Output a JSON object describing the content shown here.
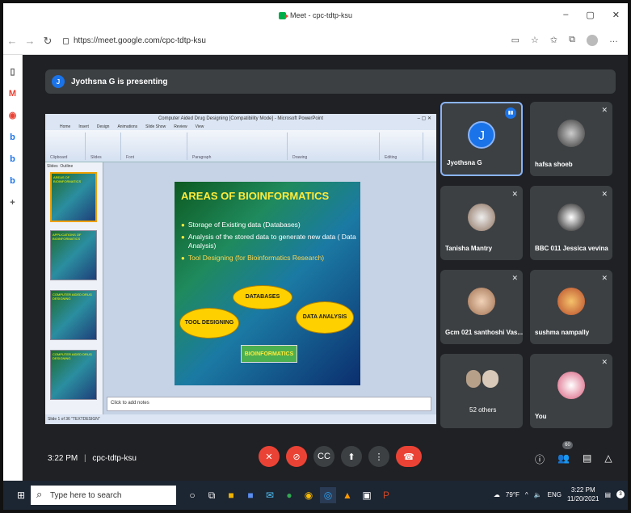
{
  "browser": {
    "tab_title": "Meet - cpc-tdtp-ksu",
    "url": "https://meet.google.com/cpc-tdtp-ksu",
    "window_controls": {
      "minimize": "–",
      "maximize": "▢",
      "close": "✕"
    }
  },
  "meet": {
    "banner_text": "Jyothsna G is presenting",
    "time": "3:22 PM",
    "separator": "|",
    "meeting_code": "cpc-tdtp-ksu",
    "people_count": "60"
  },
  "presentation": {
    "window_title": "Computer Aided Drug Designing [Compatibility Mode] - Microsoft PowerPoint",
    "ribbon_tabs": [
      "Home",
      "Insert",
      "Design",
      "Animations",
      "Slide Show",
      "Review",
      "View"
    ],
    "ribbon_groups": [
      "Clipboard",
      "Slides",
      "Font",
      "Paragraph",
      "Drawing",
      "Editing"
    ],
    "panel_tabs": [
      "Slides",
      "Outline"
    ],
    "thumbnails": [
      {
        "num": "",
        "title": "AREAS OF BIOINFORMATICS"
      },
      {
        "num": "",
        "title": "APPLICATIONS OF BIOINFORMATICS"
      },
      {
        "num": "",
        "title": "COMPUTER AIDED DRUG DESIGNING"
      },
      {
        "num": "",
        "title": "COMPUTER AIDED DRUG DESIGNING"
      }
    ],
    "slide": {
      "title": "AREAS OF BIOINFORMATICS",
      "bullets": [
        "Storage of Existing data (Databases)",
        "Analysis of the stored data to generate new data ( Data Analysis)",
        "Tool Designing (for Bioinformatics Research)"
      ],
      "ellipse_databases": "DATABASES",
      "ellipse_tool": "TOOL DESIGNING",
      "ellipse_data": "DATA ANALYSIS",
      "center_box": "BIOINFORMATICS"
    },
    "notes_placeholder": "Click to add notes",
    "status_text": "Slide 1 of 36   \"TEXTDESIGN\""
  },
  "participants": [
    {
      "name": "Jyothsna G",
      "initial": "J",
      "speaking": true
    },
    {
      "name": "hafsa shoeb",
      "muted": true
    },
    {
      "name": "Tanisha Mantry",
      "muted": true
    },
    {
      "name": "BBC 011 Jessica vevina",
      "muted": true
    },
    {
      "name": "Gcm 021 santhoshi Vas...",
      "muted": true
    },
    {
      "name": "sushma nampally",
      "muted": true
    },
    {
      "name": "52 others"
    },
    {
      "name": "You",
      "muted": true
    }
  ],
  "taskbar": {
    "search_placeholder": "Type here to search",
    "weather": "79°F",
    "lang": "ENG",
    "time": "3:22 PM",
    "date": "11/20/2021",
    "notifications": "3"
  },
  "colors": {
    "meet_bg": "#202124",
    "tile_bg": "#3c4043",
    "end_call": "#ea4335",
    "accent": "#1a73e8",
    "slide_title": "#ffeb3b"
  }
}
